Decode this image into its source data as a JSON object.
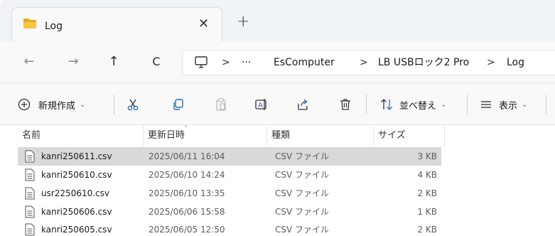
{
  "tab": {
    "title": "Log",
    "close_glyph": "✕",
    "new_tab_glyph": "+",
    "icon": "folder-icon"
  },
  "nav": {
    "back_glyph": "←",
    "forward_glyph": "→",
    "up_glyph": "↑",
    "refresh_glyph": "C"
  },
  "address": {
    "more": "···",
    "separator": ">",
    "crumbs": [
      "EsComputer",
      "LB USBロック2 Pro",
      "Log"
    ]
  },
  "commands": {
    "new": "新規作成",
    "sort": "並べ替え",
    "view": "表示",
    "chevron": "⌄"
  },
  "columns": {
    "name": "名前",
    "date": "更新日時",
    "type": "種類",
    "size": "サイズ"
  },
  "files": [
    {
      "name": "kanri250611.csv",
      "date": "2025/06/11 16:04",
      "type": "CSV ファイル",
      "size": "3 KB"
    },
    {
      "name": "kanri250610.csv",
      "date": "2025/06/10 14:24",
      "type": "CSV ファイル",
      "size": "4 KB"
    },
    {
      "name": "usr2250610.csv",
      "date": "2025/06/10 13:35",
      "type": "CSV ファイル",
      "size": "2 KB"
    },
    {
      "name": "kanri250606.csv",
      "date": "2025/06/06 15:58",
      "type": "CSV ファイル",
      "size": "1 KB"
    },
    {
      "name": "kanri250605.csv",
      "date": "2025/06/05 12:50",
      "type": "CSV ファイル",
      "size": "2 KB"
    }
  ],
  "colors": {
    "folder": "#f6c343",
    "selected_row": "#d9d9d9",
    "accent": "#0067c0"
  }
}
